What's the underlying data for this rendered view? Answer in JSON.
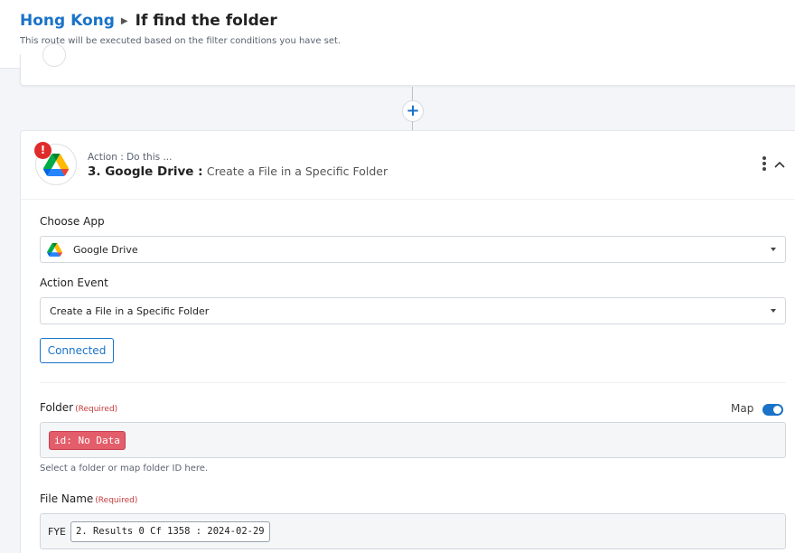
{
  "breadcrumb": {
    "parent": "Hong Kong",
    "current": "If find the folder"
  },
  "subtitle": "This route will be executed based on the filter conditions you have set.",
  "step": {
    "meta": "Action : Do this ...",
    "number_app": "3. Google Drive :",
    "event": "Create a File in a Specific Folder",
    "warning": "!"
  },
  "add_step_label": "+",
  "choose_app": {
    "label": "Choose App",
    "value": "Google Drive"
  },
  "action_event": {
    "label": "Action Event",
    "value": "Create a File in a Specific Folder"
  },
  "connected_label": "Connected",
  "folder": {
    "label": "Folder",
    "required": "(Required)",
    "map_label": "Map",
    "map_enabled": true,
    "tag": "id: No Data",
    "help": "Select a folder or map folder ID here."
  },
  "file_name": {
    "label": "File Name",
    "required": "(Required)",
    "prefix": "FYE",
    "tag": "2. Results 0 Cf 1358 : 2024-02-29"
  },
  "colors": {
    "accent": "#1a73c8",
    "error": "#e02b2b",
    "tag_red": "#e35d6a"
  },
  "icons": [
    "chevron-right-icon",
    "plus-icon",
    "google-drive-icon",
    "warning-icon",
    "kebab-icon",
    "chevron-up-icon",
    "caret-down-icon"
  ]
}
